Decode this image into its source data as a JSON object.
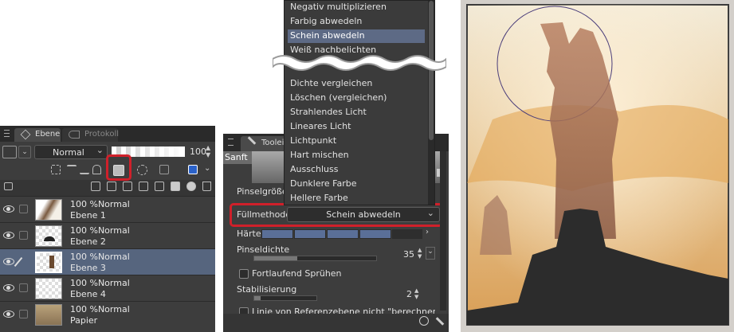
{
  "layer_panel": {
    "tab_layer": "Ebene",
    "tab_history": "Protokoll",
    "blend_mode": "Normal",
    "opacity": "100",
    "layers": [
      {
        "opacity_mode": "100 %Normal",
        "name": "Ebene 1",
        "selected": false
      },
      {
        "opacity_mode": "100 %Normal",
        "name": "Ebene 2",
        "selected": false
      },
      {
        "opacity_mode": "100 %Normal",
        "name": "Ebene 3",
        "selected": true
      },
      {
        "opacity_mode": "100 %Normal",
        "name": "Ebene 4",
        "selected": false
      },
      {
        "opacity_mode": "100 %Normal",
        "name": "Papier",
        "selected": false
      }
    ]
  },
  "tool_panel": {
    "tab_label": "Toolei",
    "preset_label": "Sanft",
    "brush_size_label": "Pinselgröße",
    "fill_mode_label": "Füllmethode",
    "fill_mode_value": "Schein abwedeln",
    "hardness_label": "Härte",
    "brush_density_label": "Pinseldichte",
    "brush_density_value": "35",
    "continuous_spray_label": "Fortlaufend Sprühen",
    "stabilization_label": "Stabilisierung",
    "stabilization_value": "2",
    "reference_label": "Linie von Referenzebene nicht \"berechnen\""
  },
  "dropdown": {
    "items_top": [
      "Negativ multiplizieren",
      "Farbig abwedeln",
      "Schein abwedeln",
      "Weiß nachbelichten"
    ],
    "items_bottom": [
      "Dichte vergleichen",
      "Löschen (vergleichen)",
      "Strahlendes Licht",
      "Lineares Licht",
      "Lichtpunkt",
      "Hart mischen",
      "Ausschluss",
      "Dunklere Farbe",
      "Hellere Farbe"
    ],
    "selected": "Schein abwedeln"
  },
  "colors": {
    "highlight": "#d0202a",
    "selected_row": "#56657e",
    "panel_bg": "#3d3d3d"
  }
}
